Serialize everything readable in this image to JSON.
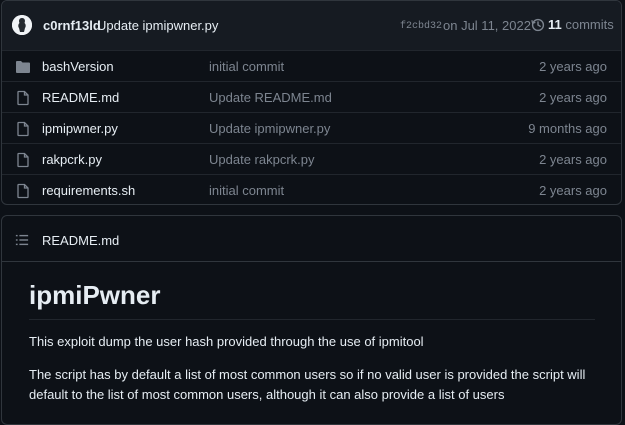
{
  "commit": {
    "author": "c0rnf13ld",
    "message": "Update ipmipwner.py",
    "sha": "f2cbd32",
    "date": "on Jul 11, 2022",
    "count": "11",
    "count_label": "commits"
  },
  "files": [
    {
      "name": "bashVersion",
      "type": "folder",
      "message": "initial commit",
      "age": "2 years ago"
    },
    {
      "name": "README.md",
      "type": "file",
      "message": "Update README.md",
      "age": "2 years ago"
    },
    {
      "name": "ipmipwner.py",
      "type": "file",
      "message": "Update ipmipwner.py",
      "age": "9 months ago"
    },
    {
      "name": "rakpcrk.py",
      "type": "file",
      "message": "Update rakpcrk.py",
      "age": "2 years ago"
    },
    {
      "name": "requirements.sh",
      "type": "file",
      "message": "initial commit",
      "age": "2 years ago"
    }
  ],
  "readme": {
    "header": "README.md",
    "heading": "ipmiPwner",
    "paragraphs": [
      "This exploit dump the user hash provided through the use of ipmitool",
      "The script has by default a list of most common users so if no valid user is provided the script will default to the list of most common users, although it can also provide a list of users"
    ]
  },
  "colors": {
    "background": "#0d1117",
    "panel": "#161b22",
    "border": "#30363d",
    "muted": "#7d8590",
    "text": "#e6edf3"
  }
}
